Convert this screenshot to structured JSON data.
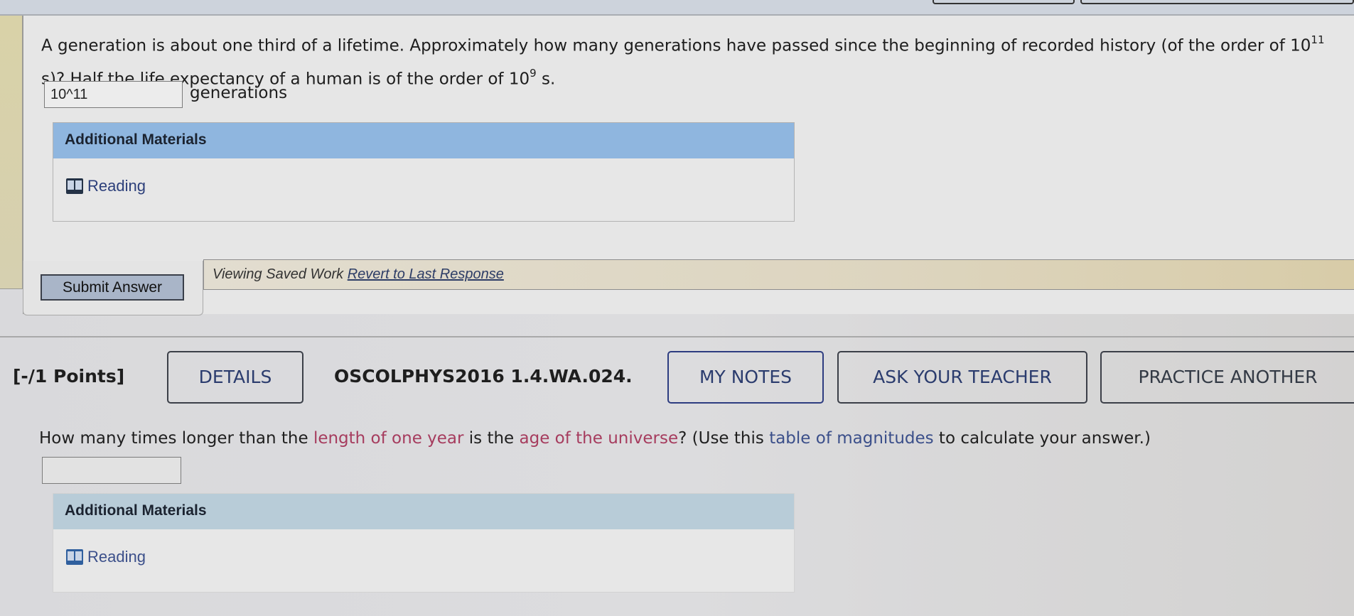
{
  "question1": {
    "text_part1": "A generation is about one third of a lifetime. Approximately how many generations have passed since the beginning of recorded history (of the order of 10",
    "exp1": "11",
    "text_part2": " s)? Half the life expectancy of a human is of the order of 10",
    "exp2": "9",
    "text_part3": " s.",
    "answer_value": "10^11",
    "unit_label": "generations",
    "additional_materials": {
      "header": "Additional Materials",
      "items": [
        {
          "label": "Reading",
          "icon": "book-icon"
        }
      ]
    },
    "submit_label": "Submit Answer",
    "saved_banner": {
      "status": "Viewing Saved Work ",
      "revert_link": "Revert to Last Response"
    }
  },
  "question2": {
    "points": "[-/1 Points]",
    "details_label": "DETAILS",
    "code": "OSCOLPHYS2016 1.4.WA.024.",
    "my_notes_label": "MY NOTES",
    "ask_teacher_label": "ASK YOUR TEACHER",
    "practice_another_label": "PRACTICE ANOTHER",
    "text": {
      "t1": "How many times longer than the ",
      "link1": "length of one year",
      "t2": " is the ",
      "link2": "age of the universe",
      "t3": "? (Use this ",
      "link3": "table of magnitudes",
      "t4": " to calculate your answer.)"
    },
    "answer_value": "",
    "additional_materials": {
      "header": "Additional Materials",
      "items": [
        {
          "label": "Reading",
          "icon": "book-icon"
        }
      ]
    }
  },
  "colors": {
    "link_red": "#a63c5e",
    "link_blue": "#3b4f8a",
    "am_header_blue": "#8fb6df",
    "submit_bg": "#a9b5c8",
    "saved_banner": "#ddd5bf"
  }
}
